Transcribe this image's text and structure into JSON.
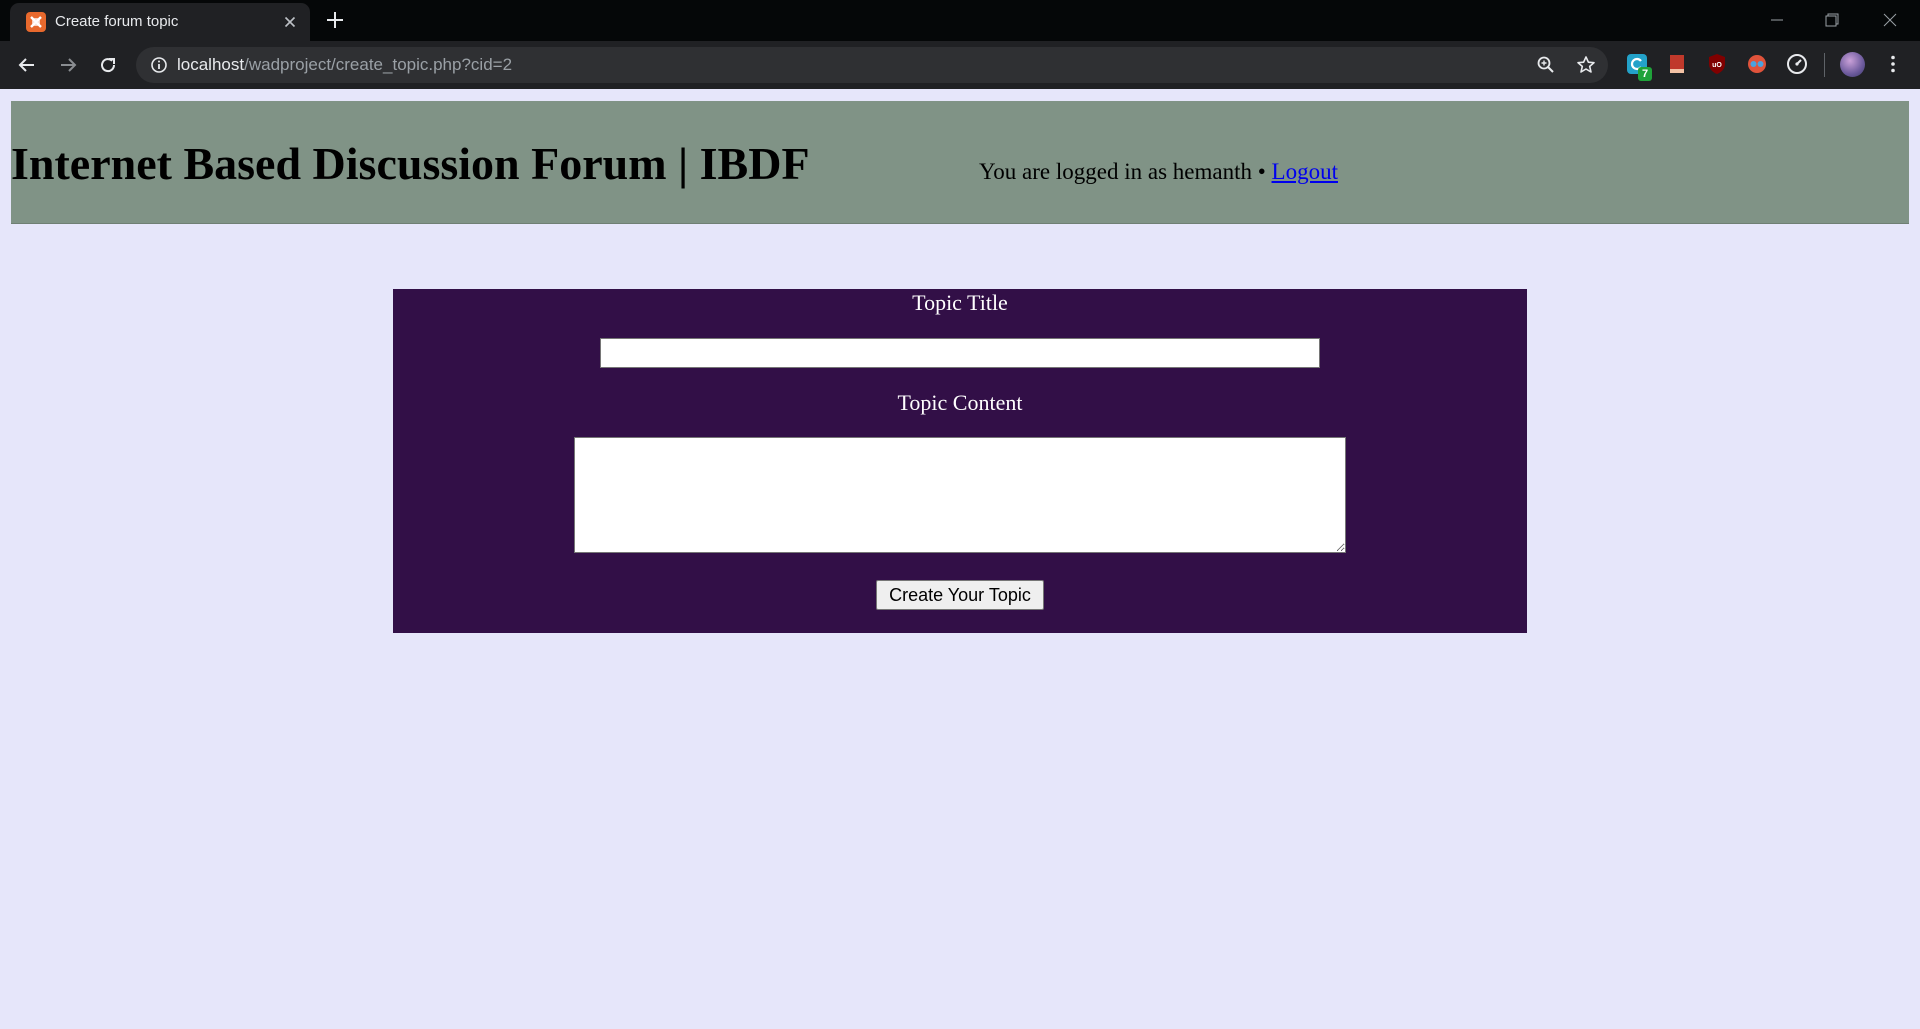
{
  "browser": {
    "tab_title": "Create forum topic",
    "url_host": "localhost",
    "url_path": "/wadproject/create_topic.php?cid=2",
    "extension_badge": "7"
  },
  "header": {
    "site_title": "Internet Based Discussion Forum | IBDF",
    "login_prefix": "You are logged in as hemanth • ",
    "logout_label": "Logout"
  },
  "form": {
    "title_label": "Topic Title",
    "title_value": "",
    "content_label": "Topic Content",
    "content_value": "",
    "submit_label": "Create Your Topic"
  },
  "colors": {
    "page_background": "#e6e6fa",
    "header_background": "#809386",
    "form_background": "#320f47",
    "browser_chrome": "#202124"
  }
}
